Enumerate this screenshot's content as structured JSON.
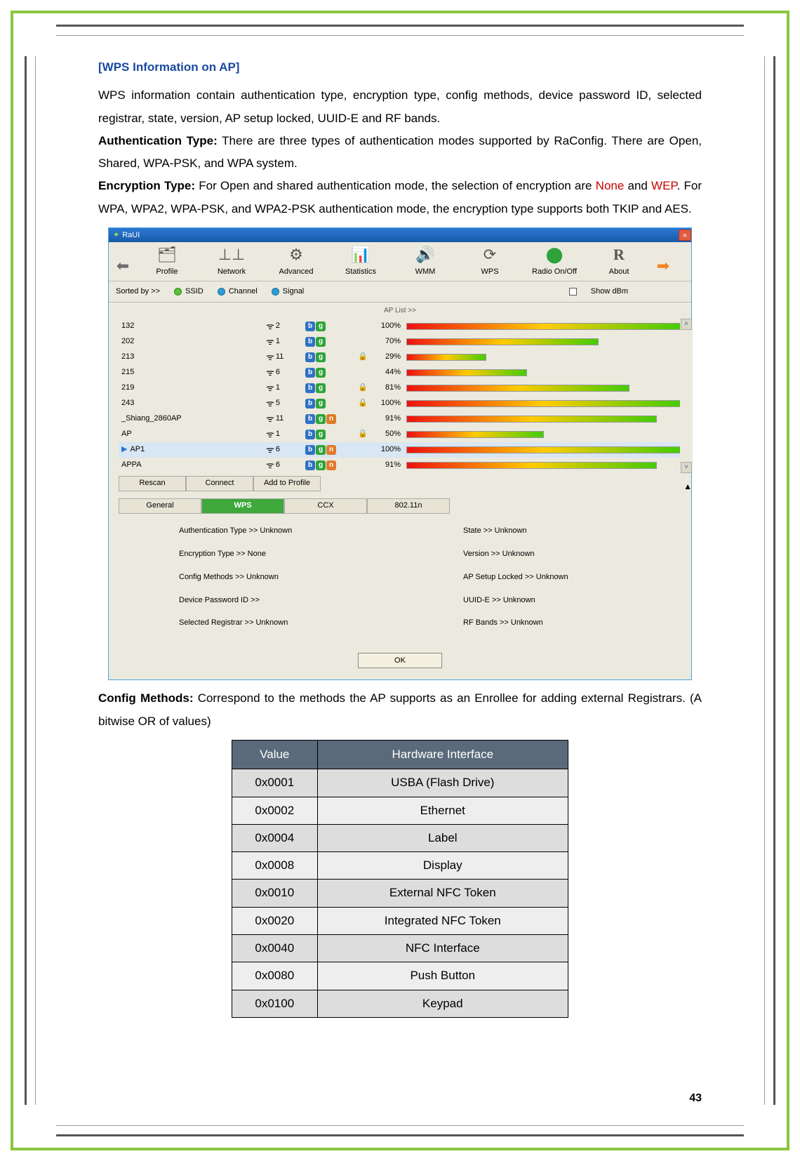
{
  "sectionTitle": "[WPS Information on AP]",
  "para1": "WPS information contain authentication type, encryption type, config methods, device password ID, selected registrar, state, version, AP setup locked, UUID-E and RF bands.",
  "authLabel": "Authentication Type:",
  "authText": " There are three types of authentication modes supported by RaConfig. There are Open, Shared, WPA-PSK, and WPA system.",
  "encLabel": "Encryption Type:",
  "encText1": " For Open and shared authentication mode, the selection of encryption are ",
  "none": "None",
  "and": " and ",
  "wep": "WEP",
  "encText2": ". For WPA, WPA2, WPA-PSK, and WPA2-PSK authentication mode, the encryption type supports both TKIP and AES.",
  "cfgLabel": "Config Methods:",
  "cfgText": " Correspond to the methods the AP supports as an Enrollee for adding external Registrars. (A bitwise OR of values)",
  "pageNumber": "43",
  "app": {
    "title": "RaUI",
    "toolbar": [
      "Profile",
      "Network",
      "Advanced",
      "Statistics",
      "WMM",
      "WPS",
      "Radio On/Off",
      "About"
    ],
    "sortedBy": "Sorted by >>",
    "sortOptions": {
      "ssid": "SSID",
      "channel": "Channel",
      "signal": "Signal"
    },
    "showDbm": "Show dBm",
    "apListLabel": "AP List >>",
    "rows": [
      {
        "ssid": "132",
        "ch": "2",
        "modes": "bg",
        "lock": false,
        "pct": 100
      },
      {
        "ssid": "202",
        "ch": "1",
        "modes": "bg",
        "lock": false,
        "pct": 70
      },
      {
        "ssid": "213",
        "ch": "11",
        "modes": "bg",
        "lock": true,
        "pct": 29
      },
      {
        "ssid": "215",
        "ch": "6",
        "modes": "bg",
        "lock": false,
        "pct": 44
      },
      {
        "ssid": "219",
        "ch": "1",
        "modes": "bg",
        "lock": true,
        "pct": 81
      },
      {
        "ssid": "243",
        "ch": "5",
        "modes": "bg",
        "lock": true,
        "pct": 100
      },
      {
        "ssid": "_Shiang_2860AP",
        "ch": "11",
        "modes": "bgn",
        "lock": false,
        "pct": 91
      },
      {
        "ssid": "AP",
        "ch": "1",
        "modes": "bg",
        "lock": true,
        "pct": 50
      },
      {
        "ssid": "AP1",
        "ch": "6",
        "modes": "bgn",
        "lock": false,
        "pct": 100,
        "sel": true
      },
      {
        "ssid": "APPA",
        "ch": "6",
        "modes": "bgn",
        "lock": false,
        "pct": 91
      }
    ],
    "buttons": {
      "rescan": "Rescan",
      "connect": "Connect",
      "addProfile": "Add to Profile"
    },
    "tabs": {
      "general": "General",
      "wps": "WPS",
      "ccx": "CCX",
      "n": "802.11n"
    },
    "wps": {
      "auth": "Authentication Type >> Unknown",
      "enc": "Encryption Type >> None",
      "cfg": "Config Methods >> Unknown",
      "dpid": "Device Password ID >>",
      "selreg": "Selected Registrar >> Unknown",
      "state": "State >> Unknown",
      "ver": "Version >> Unknown",
      "aplock": "AP Setup Locked >> Unknown",
      "uuid": "UUID-E >> Unknown",
      "rf": "RF Bands >> Unknown"
    },
    "ok": "OK"
  },
  "table": {
    "hValue": "Value",
    "hHw": "Hardware Interface",
    "rows": [
      [
        "0x0001",
        "USBA (Flash Drive)"
      ],
      [
        "0x0002",
        "Ethernet"
      ],
      [
        "0x0004",
        "Label"
      ],
      [
        "0x0008",
        "Display"
      ],
      [
        "0x0010",
        "External NFC Token"
      ],
      [
        "0x0020",
        "Integrated NFC Token"
      ],
      [
        "0x0040",
        "NFC Interface"
      ],
      [
        "0x0080",
        "Push Button"
      ],
      [
        "0x0100",
        "Keypad"
      ]
    ]
  }
}
